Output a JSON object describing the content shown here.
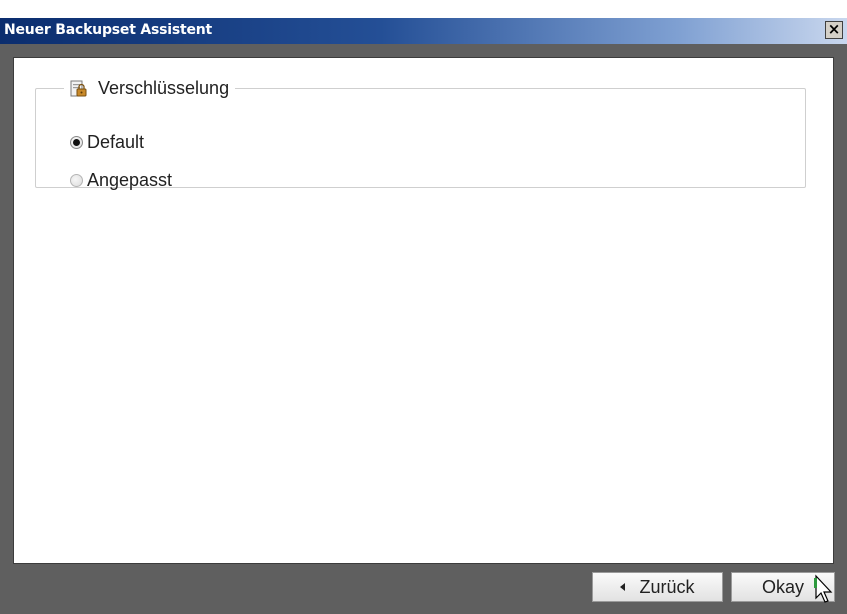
{
  "window": {
    "title": "Neuer Backupset Assistent",
    "close_label": "×"
  },
  "group": {
    "legend": "Verschlüsselung",
    "icon": "lock-icon",
    "options": [
      {
        "label": "Default",
        "checked": true
      },
      {
        "label": "Angepasst",
        "checked": false
      }
    ]
  },
  "footer": {
    "back_label": "Zurück",
    "ok_label": "Okay"
  },
  "colors": {
    "titlebar_start": "#0b2d6e",
    "titlebar_end": "#c9d7ee",
    "window_bg": "#5f5f5f"
  }
}
